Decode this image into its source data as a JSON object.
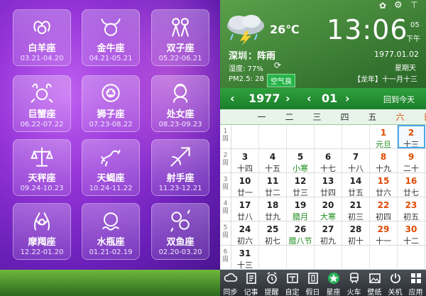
{
  "zodiac": [
    {
      "name": "白羊座",
      "dates": "03.21-04.20",
      "icon": "aries-icon"
    },
    {
      "name": "金牛座",
      "dates": "04.21-05.21",
      "icon": "taurus-icon"
    },
    {
      "name": "双子座",
      "dates": "05.22-06.21",
      "icon": "gemini-icon"
    },
    {
      "name": "巨蟹座",
      "dates": "06.22-07.22",
      "icon": "cancer-icon"
    },
    {
      "name": "狮子座",
      "dates": "07.23-08.22",
      "icon": "leo-icon"
    },
    {
      "name": "处女座",
      "dates": "08.23-09.23",
      "icon": "virgo-icon"
    },
    {
      "name": "天秤座",
      "dates": "09.24-10.23",
      "icon": "libra-icon"
    },
    {
      "name": "天蝎座",
      "dates": "10.24-11.22",
      "icon": "scorpio-icon"
    },
    {
      "name": "射手座",
      "dates": "11.23-12.21",
      "icon": "sagittarius-icon"
    },
    {
      "name": "摩羯座",
      "dates": "12.22-01.20",
      "icon": "capricorn-icon"
    },
    {
      "name": "水瓶座",
      "dates": "01.21-02.19",
      "icon": "aquarius-icon"
    },
    {
      "name": "双鱼座",
      "dates": "02.20-03.20",
      "icon": "pisces-icon"
    }
  ],
  "weather": {
    "temp": "26℃",
    "city": "深圳",
    "condition": "阵雨",
    "humidity": "湿度: 77%",
    "pm25": "PM2.5: 28",
    "air_quality": "空气良"
  },
  "clock": {
    "time": "13:06",
    "seconds": "05",
    "ampm": "下午",
    "date": "1977.01.02",
    "weekday": "星期天",
    "lunar": "【龙年】十一月十三"
  },
  "calendar": {
    "year": "1977",
    "month": "01",
    "today_label": "回到今天",
    "weekdays": [
      "一",
      "二",
      "三",
      "四",
      "五",
      "六",
      "日"
    ],
    "weeks": [
      {
        "label": "1\n周",
        "cells": [
          null,
          null,
          null,
          null,
          null,
          {
            "d": "1",
            "l": "元旦",
            "type": "fest"
          },
          {
            "d": "2",
            "l": "十三",
            "type": "sel"
          }
        ]
      },
      {
        "label": "2\n周",
        "cells": [
          {
            "d": "3",
            "l": "十四"
          },
          {
            "d": "4",
            "l": "十五"
          },
          {
            "d": "5",
            "l": "小寒",
            "type": "term"
          },
          {
            "d": "6",
            "l": "十七"
          },
          {
            "d": "7",
            "l": "十八"
          },
          {
            "d": "8",
            "l": "十九"
          },
          {
            "d": "9",
            "l": "二十"
          }
        ]
      },
      {
        "label": "3\n周",
        "cells": [
          {
            "d": "10",
            "l": "廿一"
          },
          {
            "d": "11",
            "l": "廿二"
          },
          {
            "d": "12",
            "l": "廿三"
          },
          {
            "d": "13",
            "l": "廿四"
          },
          {
            "d": "14",
            "l": "廿五"
          },
          {
            "d": "15",
            "l": "廿六"
          },
          {
            "d": "16",
            "l": "廿七"
          }
        ]
      },
      {
        "label": "4\n周",
        "cells": [
          {
            "d": "17",
            "l": "廿八"
          },
          {
            "d": "18",
            "l": "廿九"
          },
          {
            "d": "19",
            "l": "腊月",
            "type": "term"
          },
          {
            "d": "20",
            "l": "大寒",
            "type": "term"
          },
          {
            "d": "21",
            "l": "初三"
          },
          {
            "d": "22",
            "l": "初四"
          },
          {
            "d": "23",
            "l": "初五"
          }
        ]
      },
      {
        "label": "5\n周",
        "cells": [
          {
            "d": "24",
            "l": "初六"
          },
          {
            "d": "25",
            "l": "初七"
          },
          {
            "d": "26",
            "l": "腊八节",
            "type": "fest"
          },
          {
            "d": "27",
            "l": "初九"
          },
          {
            "d": "28",
            "l": "初十"
          },
          {
            "d": "29",
            "l": "十一"
          },
          {
            "d": "30",
            "l": "十二"
          }
        ]
      },
      {
        "label": "6\n周",
        "cells": [
          {
            "d": "31",
            "l": "十三"
          },
          null,
          null,
          null,
          null,
          null,
          null
        ]
      }
    ]
  },
  "toolbar": [
    {
      "label": "同步",
      "icon": "cloud-icon"
    },
    {
      "label": "记事",
      "icon": "notes-icon"
    },
    {
      "label": "提醒",
      "icon": "alarm-icon"
    },
    {
      "label": "自定",
      "icon": "custom-icon"
    },
    {
      "label": "假日",
      "icon": "holiday-icon"
    },
    {
      "label": "星座",
      "icon": "star-icon"
    },
    {
      "label": "火车",
      "icon": "train-icon"
    },
    {
      "label": "壁纸",
      "icon": "wallpaper-icon"
    },
    {
      "label": "关机",
      "icon": "power-icon"
    },
    {
      "label": "应用",
      "icon": "apps-icon"
    }
  ]
}
